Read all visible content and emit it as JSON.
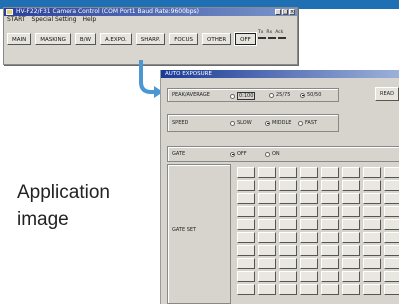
{
  "control_window": {
    "title": "HV-F22/F31 Camera Control (COM Port1 Baud Rate:9600bps)",
    "menu": [
      "START",
      "Special Setting",
      "Help"
    ],
    "toolbar": [
      "MAIN",
      "MASKING",
      "B/W",
      "A.EXPO.",
      "SHARP.",
      "FOCUS",
      "OTHER",
      "OFF"
    ],
    "indicators": [
      "Tx",
      "Rx",
      "Ack"
    ]
  },
  "ae_window": {
    "title": "AUTO EXPOSURE",
    "peak_average": {
      "label": "PEAK/AVERAGE",
      "options": [
        "0:100",
        "25/75",
        "50/50"
      ],
      "selected": "50/50"
    },
    "read_button": "READ",
    "speed": {
      "label": "SPEED",
      "options": [
        "SLOW",
        "MIDDLE",
        "FAST"
      ],
      "selected": "MIDDLE"
    },
    "gate": {
      "label": "GATE",
      "options": [
        "OFF",
        "ON"
      ],
      "selected": "OFF"
    },
    "gate_set_label": "GATE SET"
  },
  "caption": {
    "line1": "Application",
    "line2": "image"
  },
  "colors": {
    "accent": "#1f6fb4",
    "title_bar": "#2a3f9a"
  }
}
